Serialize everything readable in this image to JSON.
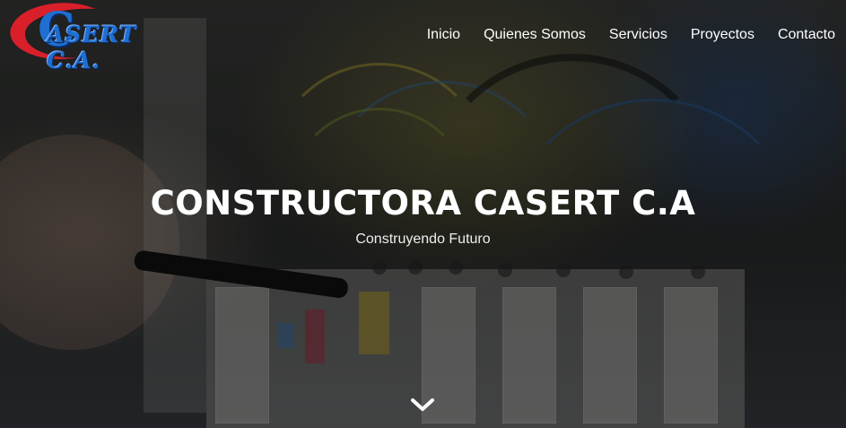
{
  "brand": {
    "logo_text": "ASERT C.A.",
    "logo_initial": "C",
    "colors": {
      "blue": "#1f6fd1",
      "red": "#d9202a"
    }
  },
  "nav": {
    "items": [
      {
        "label": "Inicio"
      },
      {
        "label": "Quienes Somos"
      },
      {
        "label": "Servicios"
      },
      {
        "label": "Proyectos"
      },
      {
        "label": "Contacto"
      }
    ]
  },
  "hero": {
    "title": "CONSTRUCTORA CASERT C.A",
    "subtitle": "Construyendo Futuro",
    "scroll_icon": "chevron-down-icon"
  }
}
